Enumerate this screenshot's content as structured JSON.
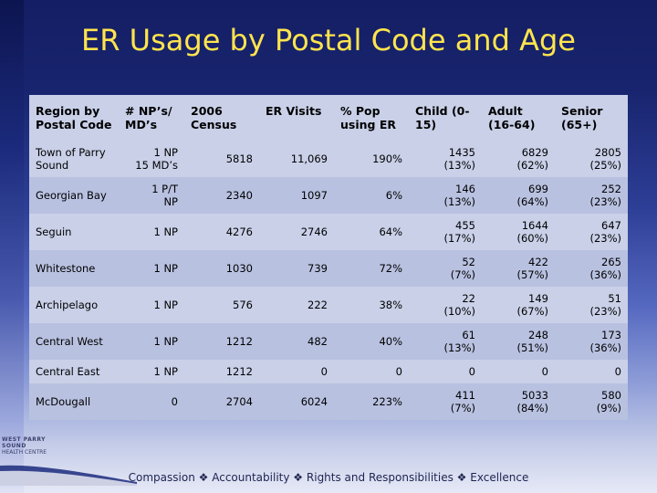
{
  "slide": {
    "title": "ER Usage by Postal Code and Age",
    "footer": "Compassion  Accountability  Rights and Responsibilities  Excellence",
    "footer_parts": [
      "Compassion",
      "Accountability",
      "Rights and Responsibilities",
      "Excellence"
    ],
    "footer_separator": "❖",
    "logo_line1": "WEST PARRY SOUND",
    "logo_line2": "HEALTH CENTRE"
  },
  "table": {
    "headers": [
      "Region by Postal Code",
      "# NP’s/ MD’s",
      "2006 Census",
      "ER Visits",
      "% Pop using ER",
      "Child (0-15)",
      "Adult (16-64)",
      "Senior (65+)"
    ],
    "rows": [
      {
        "region": "Town of Parry Sound",
        "np_md": "1 NP\n15 MD’s",
        "np_md_line1": "1 NP",
        "np_md_line2": "15 MD’s",
        "census": "5818",
        "er_visits": "11,069",
        "pct_pop": "190%",
        "child": "1435",
        "child_pct": "(13%)",
        "adult": "6829",
        "adult_pct": "(62%)",
        "senior": "2805",
        "senior_pct": "(25%)"
      },
      {
        "region": "Georgian Bay",
        "np_md_line1": "1 P/T",
        "np_md_line2": "NP",
        "census": "2340",
        "er_visits": "1097",
        "pct_pop": "6%",
        "child": "146",
        "child_pct": "(13%)",
        "adult": "699",
        "adult_pct": "(64%)",
        "senior": "252",
        "senior_pct": "(23%)"
      },
      {
        "region": "Seguin",
        "np_md_line1": "1 NP",
        "np_md_line2": "",
        "census": "4276",
        "er_visits": "2746",
        "pct_pop": "64%",
        "child": "455",
        "child_pct": "(17%)",
        "adult": "1644",
        "adult_pct": "(60%)",
        "senior": "647",
        "senior_pct": "(23%)"
      },
      {
        "region": "Whitestone",
        "np_md_line1": "1 NP",
        "np_md_line2": "",
        "census": "1030",
        "er_visits": "739",
        "pct_pop": "72%",
        "child": "52",
        "child_pct": "(7%)",
        "adult": "422",
        "adult_pct": "(57%)",
        "senior": "265",
        "senior_pct": "(36%)"
      },
      {
        "region": "Archipelago",
        "np_md_line1": "1 NP",
        "np_md_line2": "",
        "census": "576",
        "er_visits": "222",
        "pct_pop": "38%",
        "child": "22",
        "child_pct": "(10%)",
        "adult": "149",
        "adult_pct": "(67%)",
        "senior": "51",
        "senior_pct": "(23%)"
      },
      {
        "region": "Central West",
        "np_md_line1": "1 NP",
        "np_md_line2": "",
        "census": "1212",
        "er_visits": "482",
        "pct_pop": "40%",
        "child": "61",
        "child_pct": "(13%)",
        "adult": "248",
        "adult_pct": "(51%)",
        "senior": "173",
        "senior_pct": "(36%)"
      },
      {
        "region": "Central East",
        "np_md_line1": "1 NP",
        "np_md_line2": "",
        "census": "1212",
        "er_visits": "0",
        "pct_pop": "0",
        "child": "0",
        "child_pct": "",
        "adult": "0",
        "adult_pct": "",
        "senior": "0",
        "senior_pct": ""
      },
      {
        "region": "McDougall",
        "np_md_line1": "0",
        "np_md_line2": "",
        "census": "2704",
        "er_visits": "6024",
        "pct_pop": "223%",
        "child": "411",
        "child_pct": "(7%)",
        "adult": "5033",
        "adult_pct": "(84%)",
        "senior": "580",
        "senior_pct": "(9%)"
      }
    ]
  }
}
